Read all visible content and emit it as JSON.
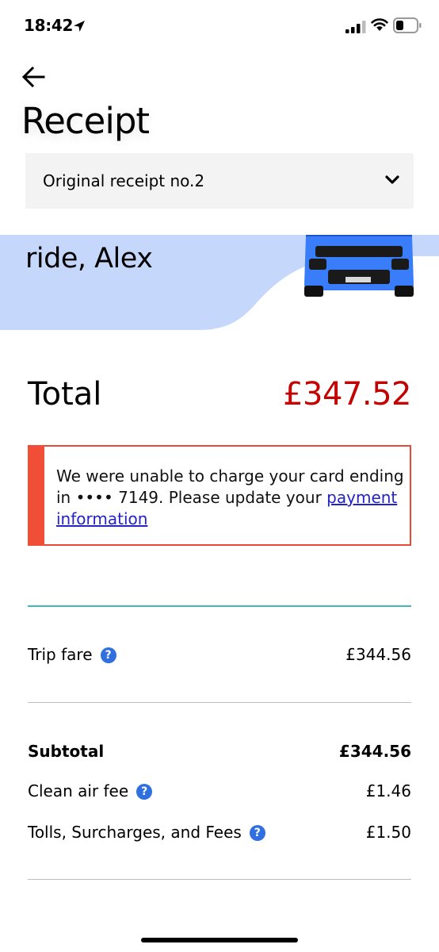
{
  "status_bar": {
    "time": "18:42",
    "icons": [
      "location-arrow-icon",
      "signal-icon",
      "wifi-icon",
      "battery-icon"
    ]
  },
  "header": {
    "back_icon": "arrow-left-icon",
    "title": "Receipt"
  },
  "receipt_selector": {
    "selected": "Original receipt no.2",
    "icon": "chevron-down-icon"
  },
  "banner": {
    "greeting": "ride, Alex",
    "background_color": "#c5d8fb",
    "illustration": "car-icon"
  },
  "total": {
    "label": "Total",
    "amount": "£347.52",
    "amount_color": "#c40000"
  },
  "alert": {
    "text_before": "We were unable to charge your card ending in •••• 7149. Please update your ",
    "link_text": "payment information",
    "accent_color": "#f04e37"
  },
  "line_items": [
    {
      "label": "Trip fare",
      "value": "£344.56",
      "help": true
    }
  ],
  "subtotal": {
    "label": "Subtotal",
    "value": "£344.56"
  },
  "fees": [
    {
      "label": "Clean air fee",
      "value": "£1.46",
      "help": true
    },
    {
      "label": "Tolls, Surcharges, and Fees",
      "value": "£1.50",
      "help": true
    }
  ],
  "help_icon_glyph": "?"
}
